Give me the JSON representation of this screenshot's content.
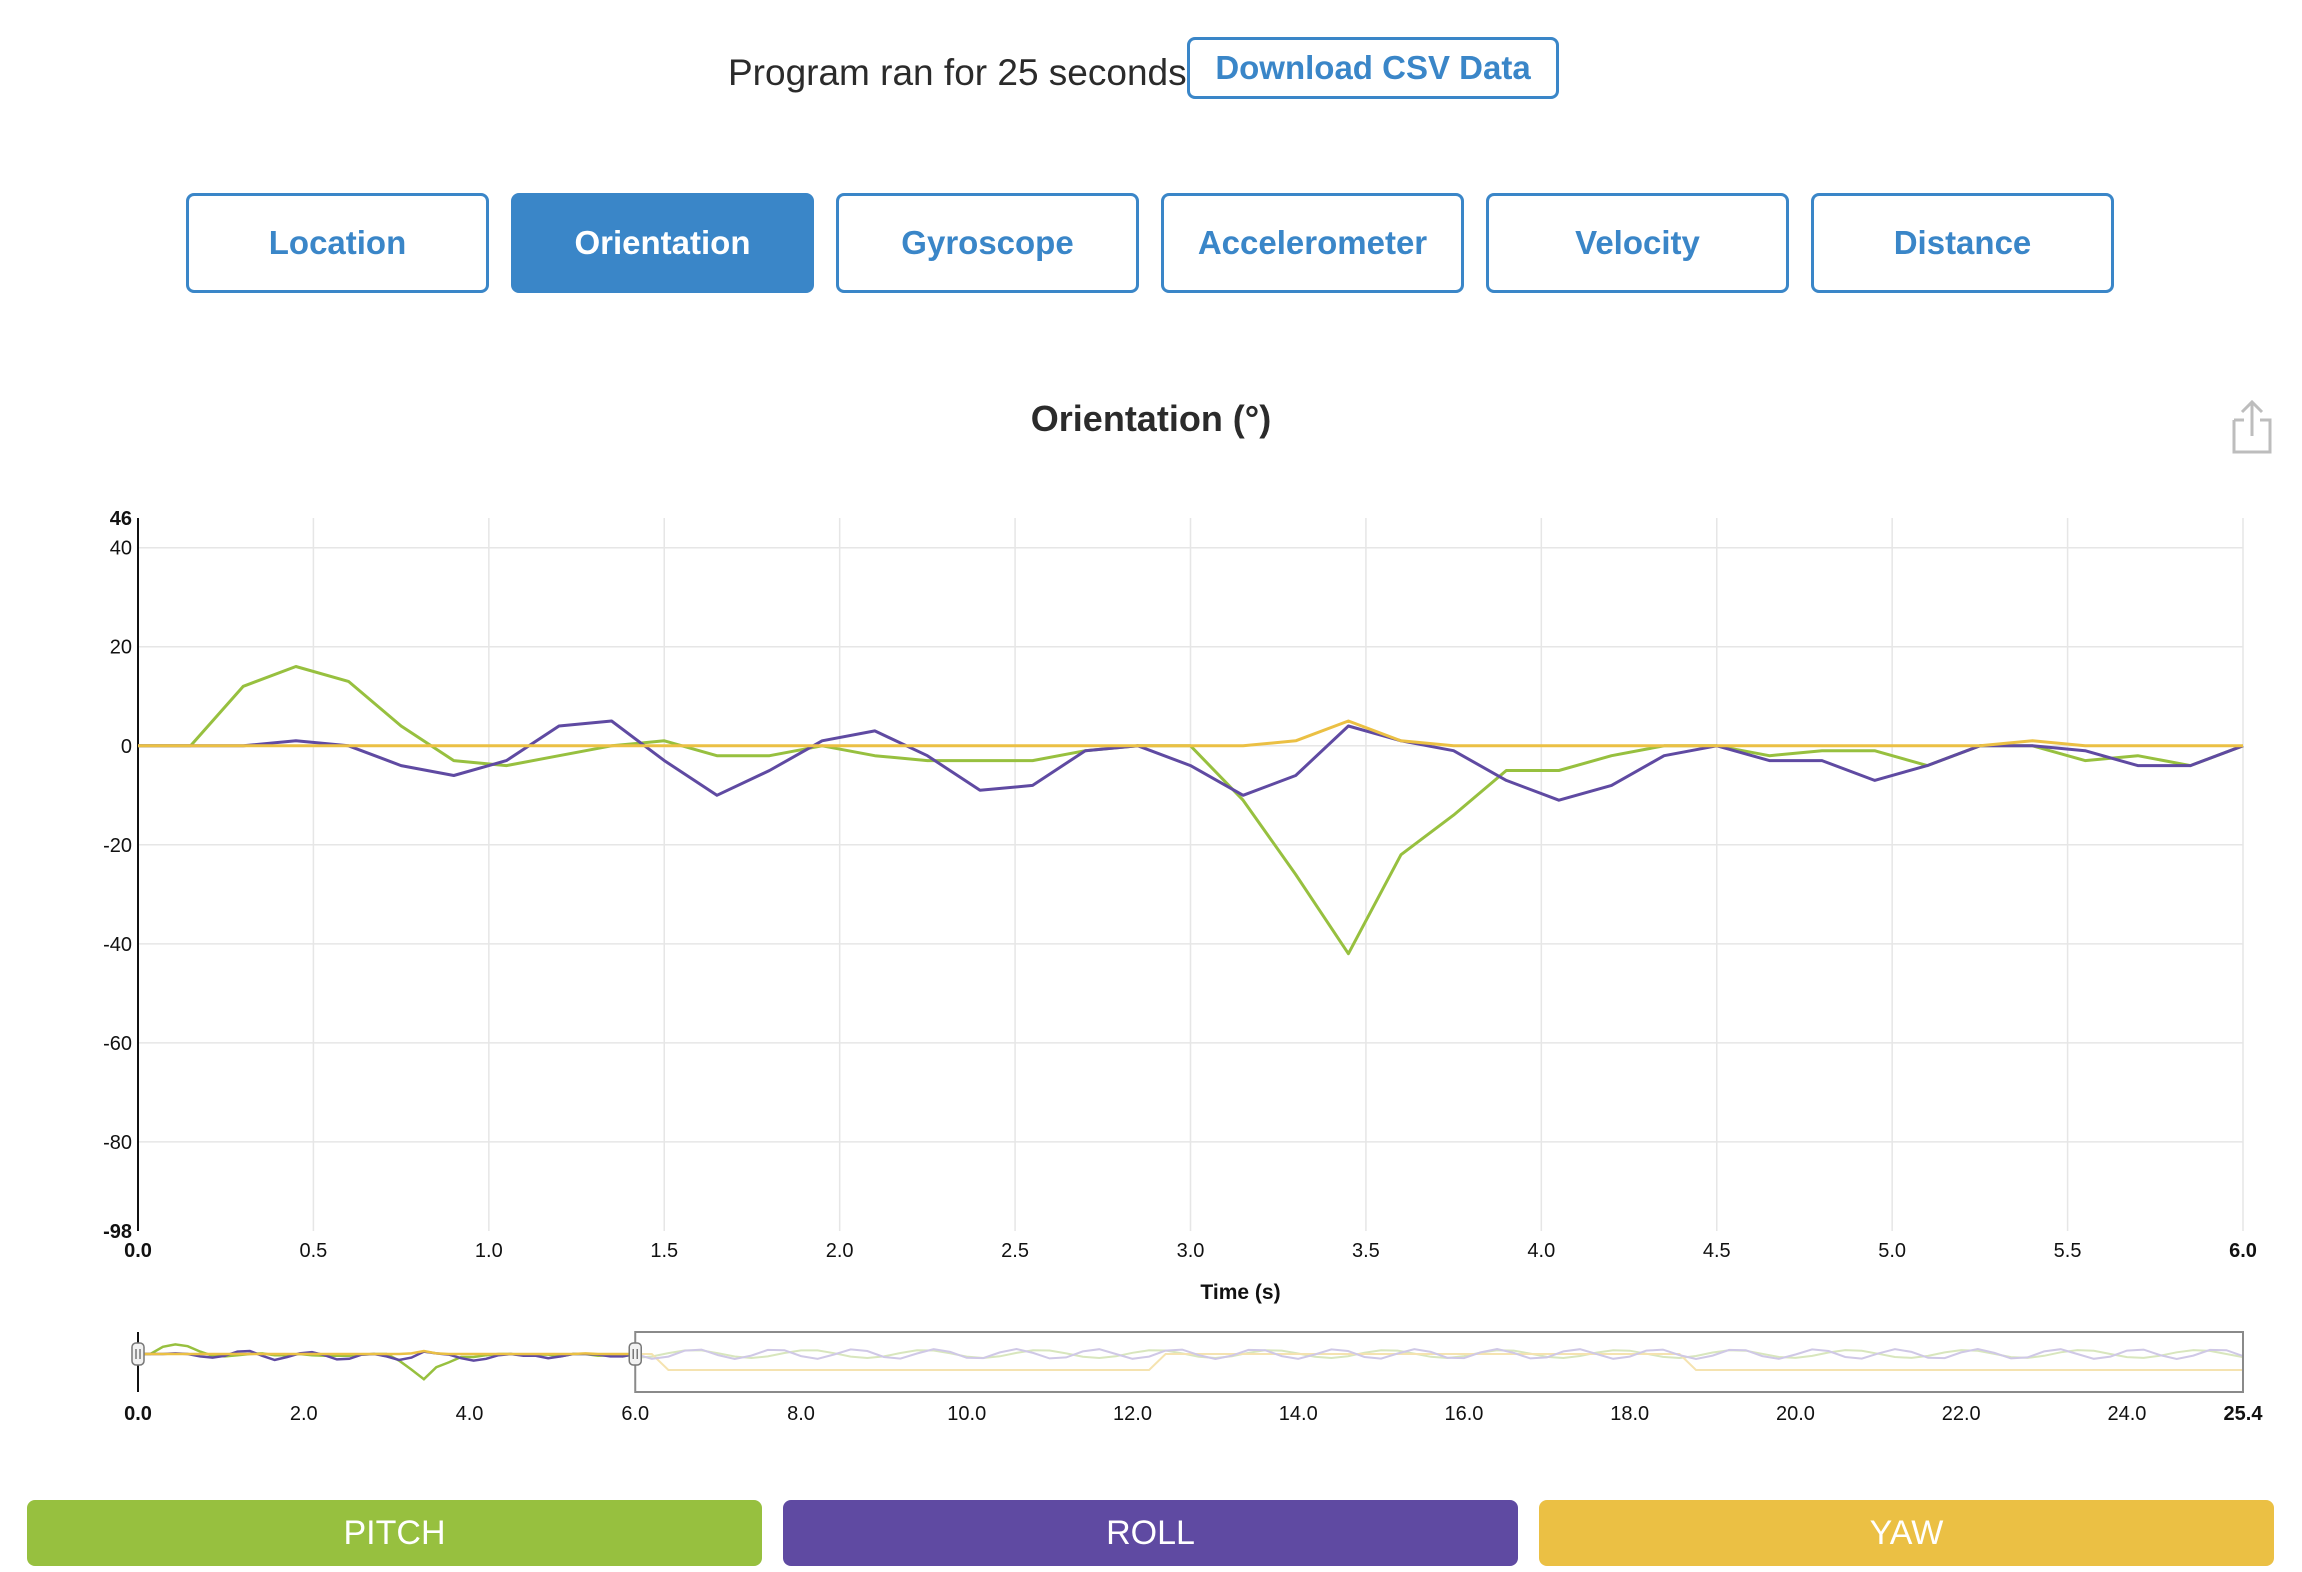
{
  "header": {
    "runtime_text": "Program ran for 25 seconds.",
    "csv_button_label": "Download CSV Data"
  },
  "tabs": [
    {
      "label": "Location",
      "active": false
    },
    {
      "label": "Orientation",
      "active": true
    },
    {
      "label": "Gyroscope",
      "active": false
    },
    {
      "label": "Accelerometer",
      "active": false
    },
    {
      "label": "Velocity",
      "active": false
    },
    {
      "label": "Distance",
      "active": false
    }
  ],
  "export_icon": "share-export-icon",
  "colors": {
    "accent": "#3a86c8",
    "pitch": "#97c03f",
    "roll": "#5f4aa2",
    "yaw": "#ebc044",
    "grid": "#e6e6e6"
  },
  "legend": [
    {
      "label": "PITCH",
      "color": "#97c03f"
    },
    {
      "label": "ROLL",
      "color": "#5f4aa2"
    },
    {
      "label": "YAW",
      "color": "#ebc044"
    }
  ],
  "chart_data": {
    "type": "line",
    "title": "Orientation (°)",
    "xlabel": "Time (s)",
    "ylabel": "",
    "xlim": [
      0.0,
      6.0
    ],
    "ylim": [
      -98,
      46
    ],
    "x_ticks": [
      "0.0",
      "0.5",
      "1.0",
      "1.5",
      "2.0",
      "2.5",
      "3.0",
      "3.5",
      "4.0",
      "4.5",
      "5.0",
      "5.5",
      "6.0"
    ],
    "y_ticks": [
      "46",
      "40",
      "20",
      "0",
      "-20",
      "-40",
      "-60",
      "-80",
      "-98"
    ],
    "grid": true,
    "x": [
      0,
      0.15,
      0.3,
      0.45,
      0.6,
      0.75,
      0.9,
      1.05,
      1.2,
      1.35,
      1.5,
      1.65,
      1.8,
      1.95,
      2.1,
      2.25,
      2.4,
      2.55,
      2.7,
      2.85,
      3.0,
      3.15,
      3.3,
      3.45,
      3.6,
      3.75,
      3.9,
      4.05,
      4.2,
      4.35,
      4.5,
      4.65,
      4.8,
      4.95,
      5.1,
      5.25,
      5.4,
      5.55,
      5.7,
      5.85,
      6.0
    ],
    "series": [
      {
        "name": "PITCH",
        "color": "#97c03f",
        "values": [
          0,
          0,
          12,
          16,
          13,
          4,
          -3,
          -4,
          -2,
          0,
          1,
          -2,
          -2,
          0,
          -2,
          -3,
          -3,
          -3,
          -1,
          0,
          0,
          -11,
          -26,
          -42,
          -22,
          -14,
          -5,
          -5,
          -2,
          0,
          0,
          -2,
          -1,
          -1,
          -4,
          0,
          0,
          -3,
          -2,
          -4,
          0
        ]
      },
      {
        "name": "ROLL",
        "color": "#5f4aa2",
        "values": [
          0,
          0,
          0,
          1,
          0,
          -4,
          -6,
          -3,
          4,
          5,
          -3,
          -10,
          -5,
          1,
          3,
          -2,
          -9,
          -8,
          -1,
          0,
          -4,
          -10,
          -6,
          4,
          1,
          -1,
          -7,
          -11,
          -8,
          -2,
          0,
          -3,
          -3,
          -7,
          -4,
          0,
          0,
          -1,
          -4,
          -4,
          0
        ]
      },
      {
        "name": "YAW",
        "color": "#ebc044",
        "values": [
          0,
          0,
          0,
          0,
          0,
          0,
          0,
          0,
          0,
          0,
          0,
          0,
          0,
          0,
          0,
          0,
          0,
          0,
          0,
          0,
          0,
          0,
          1,
          5,
          1,
          0,
          0,
          0,
          0,
          0,
          0,
          0,
          0,
          0,
          0,
          0,
          1,
          0,
          0,
          0,
          0
        ]
      }
    ],
    "navigator": {
      "xlim": [
        0.0,
        25.4
      ],
      "x_ticks": [
        "0.0",
        "2.0",
        "4.0",
        "6.0",
        "8.0",
        "10.0",
        "12.0",
        "14.0",
        "16.0",
        "18.0",
        "20.0",
        "22.0",
        "24.0",
        "25.4"
      ],
      "selected_range": [
        0.0,
        6.0
      ]
    }
  }
}
